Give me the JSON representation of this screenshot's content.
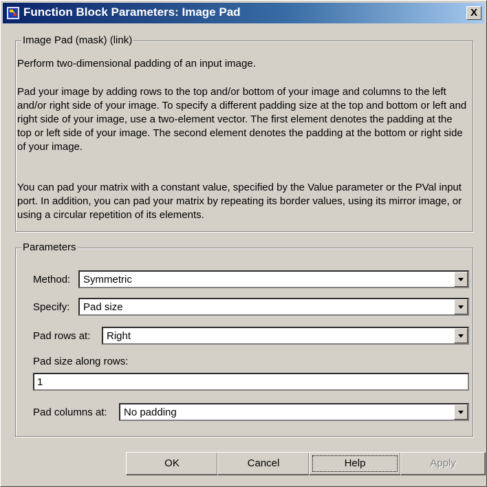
{
  "window": {
    "title": "Function Block Parameters: Image Pad",
    "close_glyph": "X"
  },
  "mask_group": {
    "legend": "Image Pad (mask) (link)",
    "paragraphs": [
      "Perform two-dimensional padding of an input image.",
      "Pad your image by adding rows to the top and/or bottom of your image and columns to the left and/or right side of your image. To specify a different padding size at the top and bottom or left and right side of your image, use a two-element vector. The first element denotes the padding at the top or left side of your image. The second element denotes the padding at the bottom or right side of your image.",
      "You can pad your matrix with a constant value, specified by the Value parameter or the PVal input port. In addition, you can pad your matrix by repeating its border values, using its mirror image, or using a circular repetition of its elements."
    ]
  },
  "params_group": {
    "legend": "Parameters",
    "method": {
      "label": "Method:",
      "value": "Symmetric"
    },
    "specify": {
      "label": "Specify:",
      "value": "Pad size"
    },
    "pad_rows_at": {
      "label": "Pad rows at:",
      "value": "Right"
    },
    "pad_size_along_rows": {
      "label": "Pad size along rows:",
      "value": "1"
    },
    "pad_columns_at": {
      "label": "Pad columns at:",
      "value": "No padding"
    }
  },
  "buttons": {
    "ok": "OK",
    "cancel": "Cancel",
    "help": "Help",
    "apply": "Apply"
  },
  "colors": {
    "face": "#d4d0c8",
    "title_start": "#0a246a",
    "title_end": "#a6caf0"
  }
}
